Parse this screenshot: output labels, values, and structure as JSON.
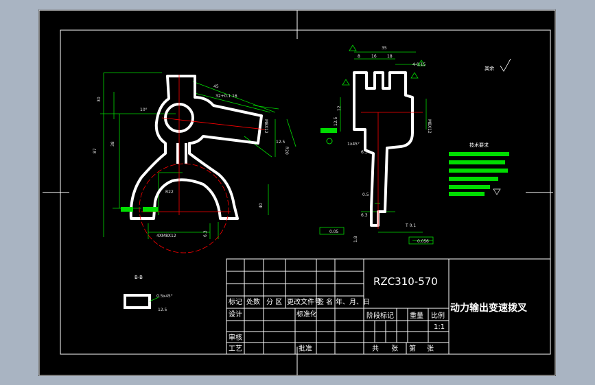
{
  "drawing": {
    "part_number": "RZC310-570",
    "part_name": "动力输出变速拨叉",
    "scale": "1:1",
    "section_label": "B-B",
    "section_dims": [
      "0.5x45°",
      "12.5"
    ],
    "roughness_note": "其余",
    "tech_req_title": "技术要求"
  },
  "title_block": {
    "header": [
      "标记",
      "处数",
      "分 区",
      "更改文件号",
      "签 名",
      "年、月、日"
    ],
    "design": "设计",
    "standardize": "标准化",
    "review": "审核",
    "process": "工艺",
    "approve": "批准",
    "stage_mark": "阶段标记",
    "weight": "重量",
    "ratio": "比例",
    "sheet_total": "共",
    "sheet_unit": "张",
    "sheet_no": "第",
    "sheet_unit2": "张"
  },
  "front_view_dims": [
    "45",
    "32+0.1 16",
    "10°",
    "M8X12",
    "12.5",
    "R20",
    "87",
    "38",
    "30",
    "R22",
    "40",
    "6.3",
    "4XM8X12"
  ],
  "side_view_dims": [
    "35",
    "8",
    "16",
    "18",
    "4-0.15",
    "12.5",
    "12",
    "M8X12",
    "1x45°",
    "6.3",
    "0.5",
    "0.05",
    "T 0.1",
    "0.05",
    "1.8",
    "6",
    "6.3"
  ],
  "colors": {
    "sheet": "#000000",
    "part": "#ffffff",
    "dimension": "#00ff00",
    "centerline": "#ff0000",
    "highlight": "#00dd00"
  }
}
